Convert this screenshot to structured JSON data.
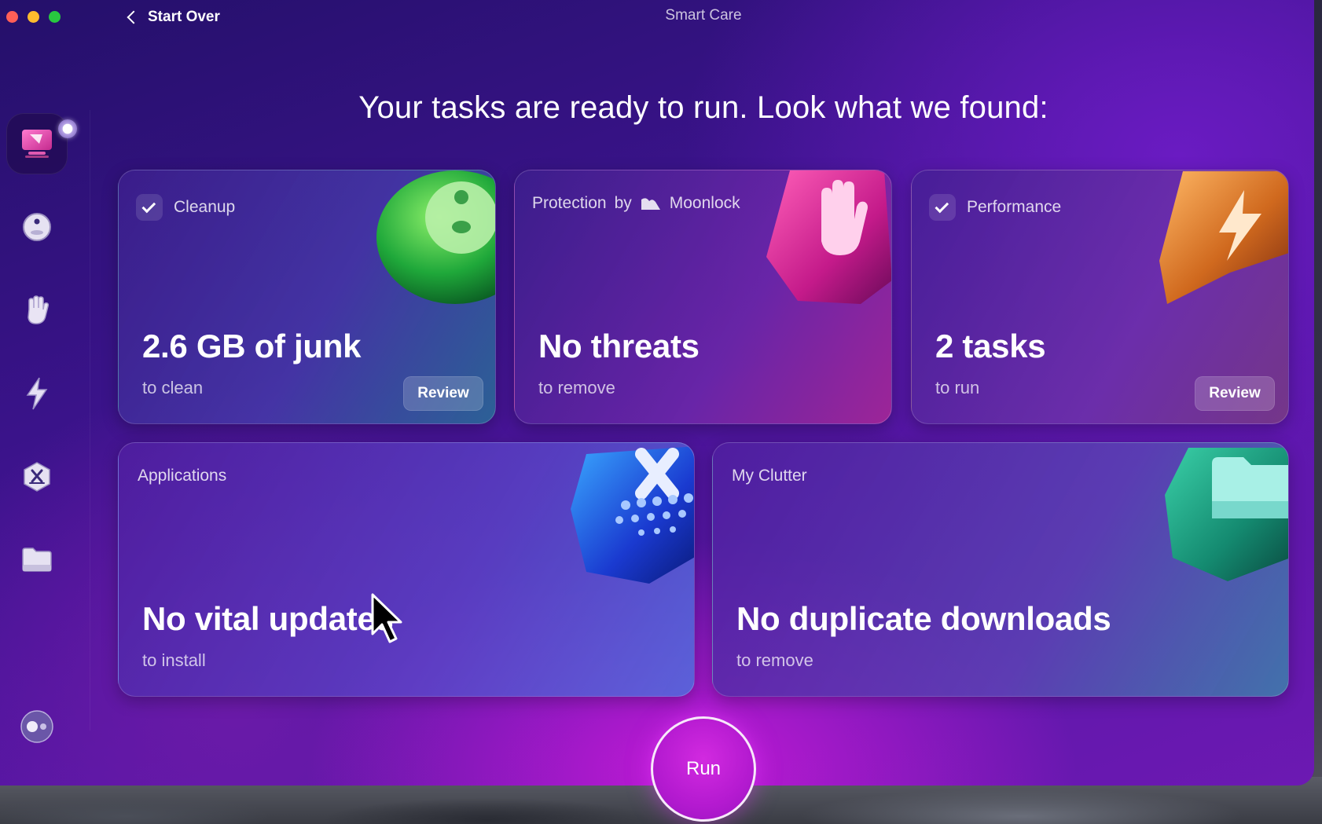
{
  "window": {
    "back_label": "Start Over",
    "title": "Smart Care"
  },
  "headline": "Your tasks are ready to run. Look what we found:",
  "sidebar": {
    "items": [
      {
        "name": "smart-care",
        "icon": "monitor-icon",
        "active": true
      },
      {
        "name": "cleanup",
        "icon": "disc-icon"
      },
      {
        "name": "protection",
        "icon": "hand-icon"
      },
      {
        "name": "performance",
        "icon": "lightning-icon"
      },
      {
        "name": "applications",
        "icon": "apps-icon"
      },
      {
        "name": "my-clutter",
        "icon": "folder-icon"
      },
      {
        "name": "assistant",
        "icon": "toggle-icon"
      }
    ]
  },
  "cards": {
    "cleanup": {
      "title": "Cleanup",
      "checked": true,
      "value": "2.6 GB of junk",
      "sub": "to clean",
      "review_label": "Review"
    },
    "protection": {
      "title": "Protection",
      "by": "by",
      "brand": "Moonlock",
      "value": "No threats",
      "sub": "to remove"
    },
    "performance": {
      "title": "Performance",
      "checked": true,
      "value": "2 tasks",
      "sub": "to run",
      "review_label": "Review"
    },
    "applications": {
      "title": "Applications",
      "value": "No vital updates",
      "sub": "to install"
    },
    "clutter": {
      "title": "My Clutter",
      "value": "No duplicate downloads",
      "sub": "to remove"
    }
  },
  "run_label": "Run",
  "colors": {
    "accent": "#c21ad6",
    "window_bg": "#3a138a",
    "traffic_red": "#ff5f57",
    "traffic_yellow": "#febc2e",
    "traffic_green": "#28c840"
  }
}
